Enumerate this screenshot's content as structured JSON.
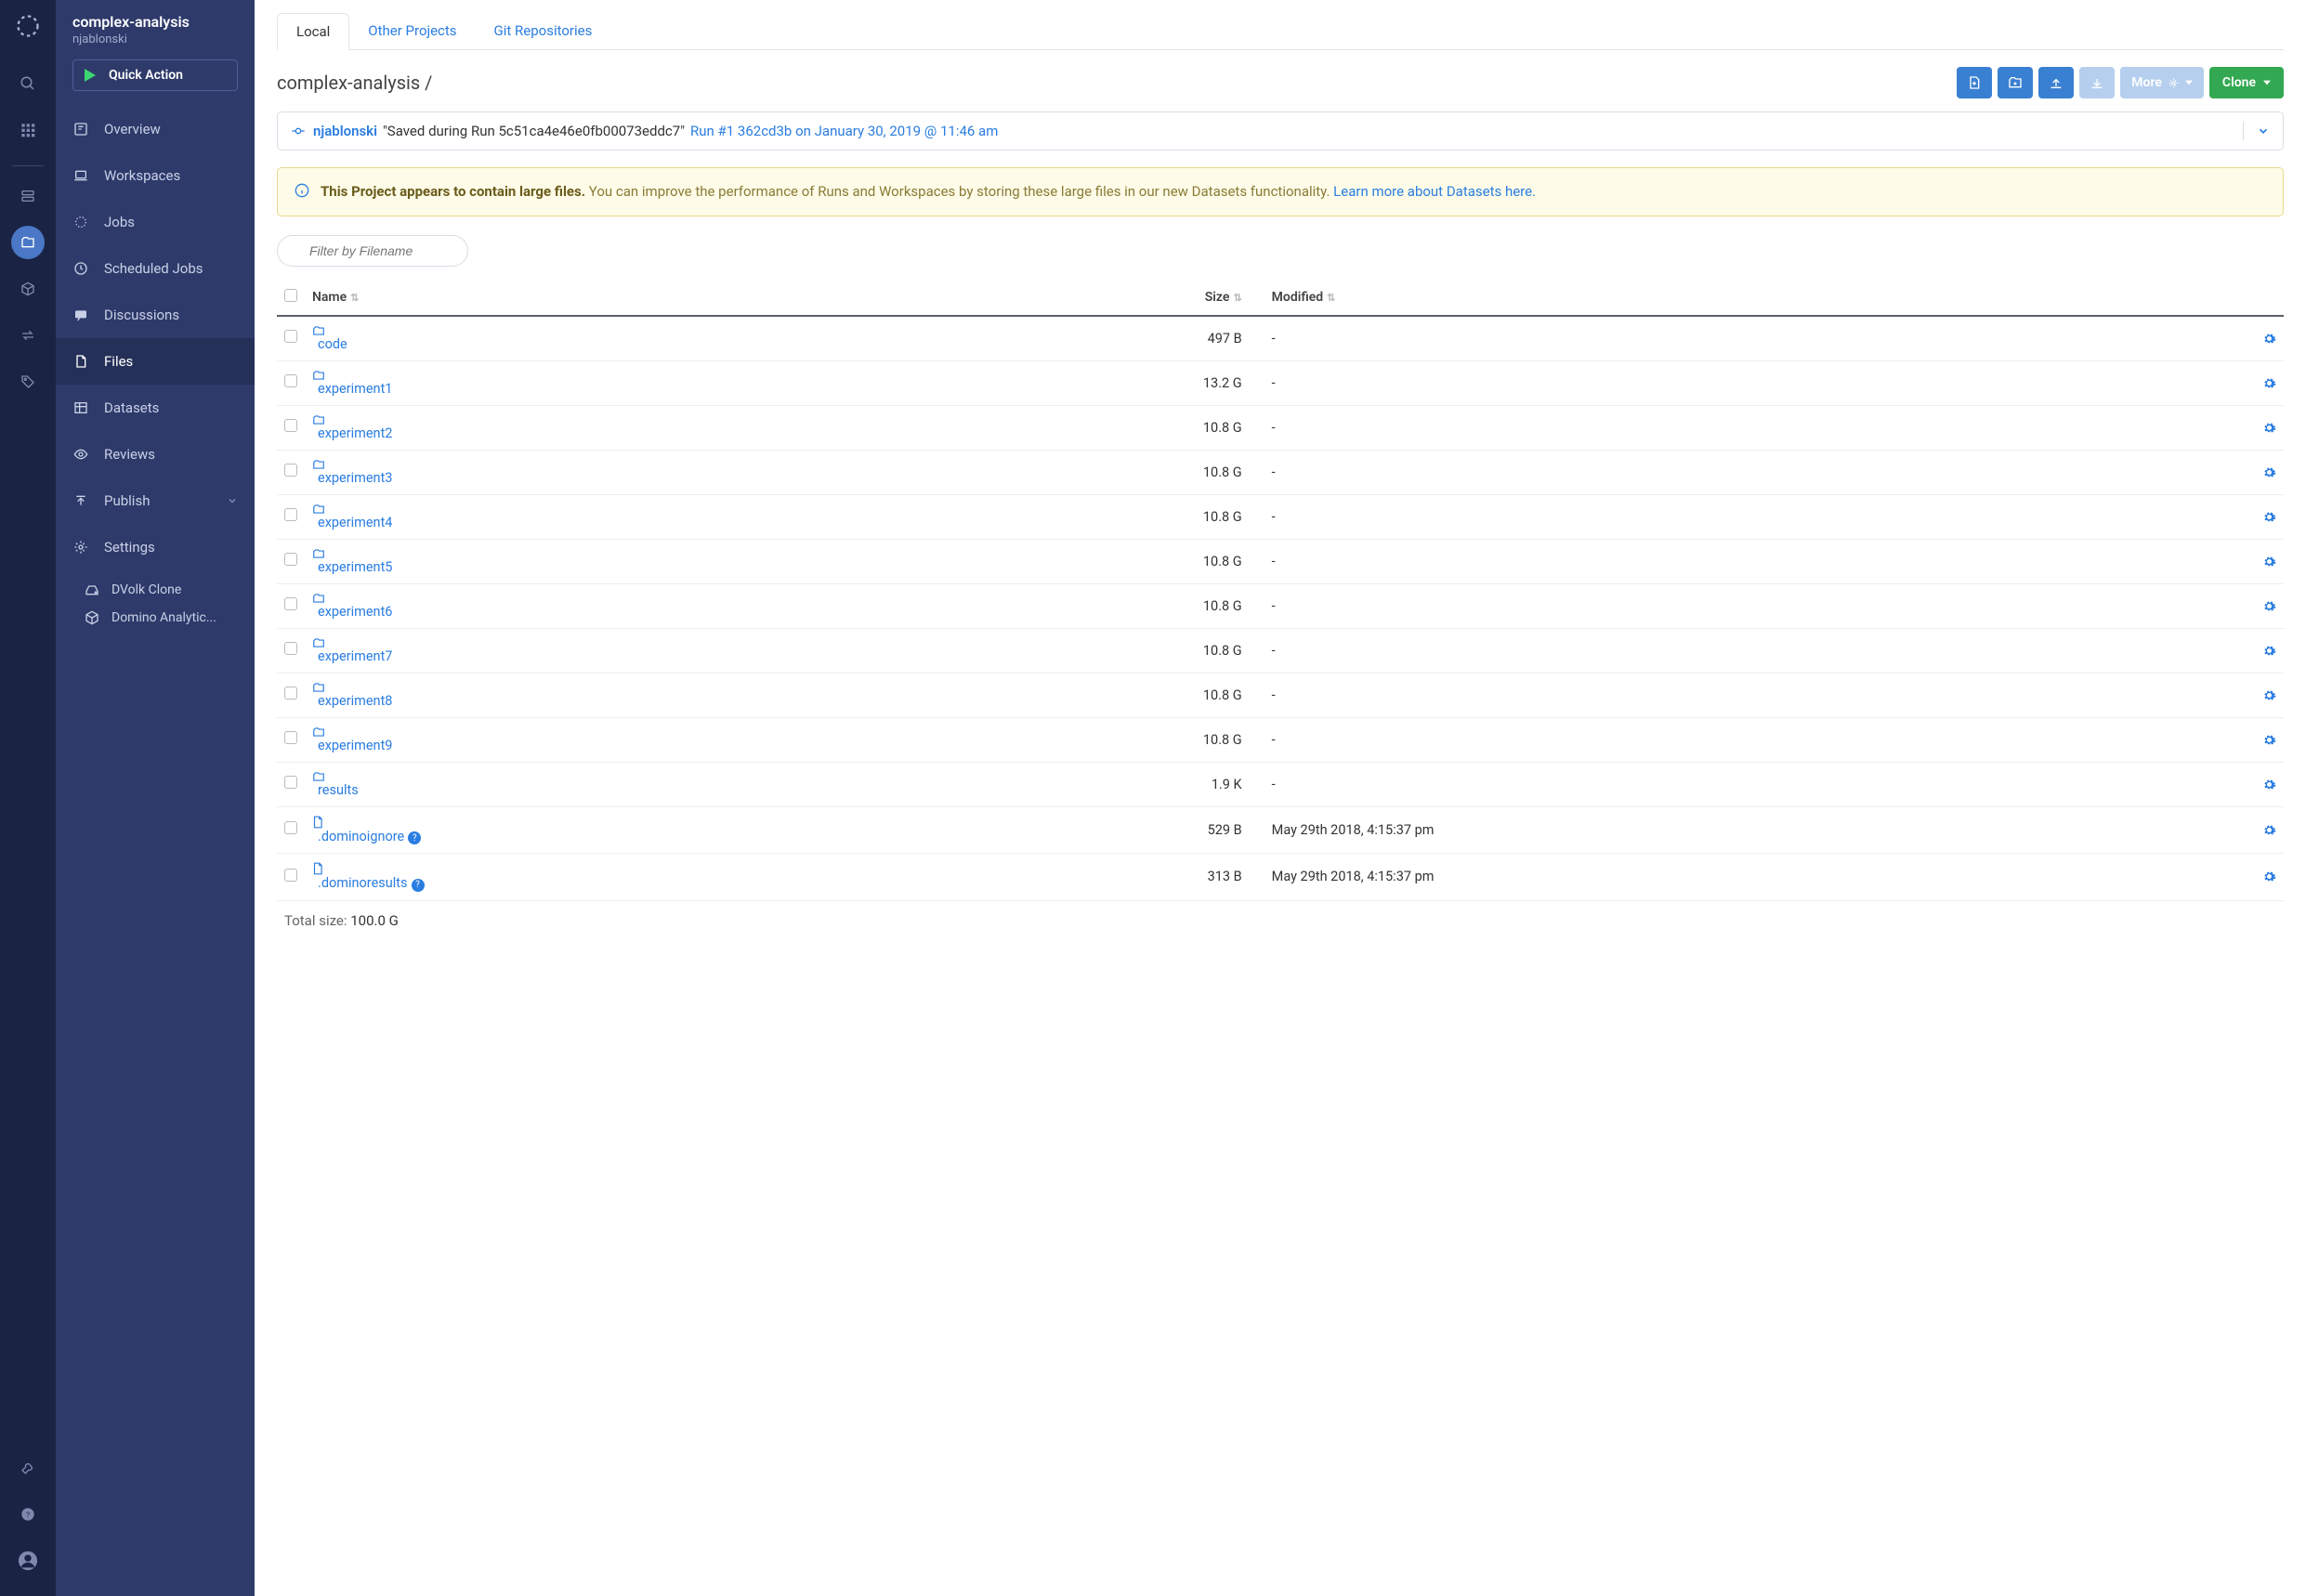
{
  "project": {
    "title": "complex-analysis",
    "owner": "njablonski"
  },
  "quick_action": "Quick Action",
  "nav": {
    "overview": "Overview",
    "workspaces": "Workspaces",
    "jobs": "Jobs",
    "scheduled": "Scheduled Jobs",
    "discussions": "Discussions",
    "files": "Files",
    "datasets": "Datasets",
    "reviews": "Reviews",
    "publish": "Publish",
    "settings": "Settings"
  },
  "drives": {
    "d1": "DVolk Clone",
    "d2": "Domino Analytic..."
  },
  "tabs": {
    "local": "Local",
    "other": "Other Projects",
    "git": "Git Repositories"
  },
  "breadcrumb": {
    "project": "complex-analysis",
    "sep": "  /"
  },
  "toolbar": {
    "more": "More",
    "clone": "Clone"
  },
  "commit": {
    "user": "njablonski",
    "msg": "\"Saved during Run 5c51ca4e46e0fb00073eddc7\"",
    "run": "Run #1 362cd3b on January 30, 2019 @ 11:46 am"
  },
  "alert": {
    "strong": "This Project appears to contain large files.",
    "text": " You can improve the performance of Runs and Workspaces by storing these large files in our new Datasets functionality. ",
    "link": "Learn more about Datasets here."
  },
  "filter": {
    "placeholder": "Filter by Filename"
  },
  "columns": {
    "name": "Name",
    "size": "Size",
    "modified": "Modified"
  },
  "files": [
    {
      "name": "code",
      "type": "folder",
      "size": "497 B",
      "modified": "-"
    },
    {
      "name": "experiment1",
      "type": "folder",
      "size": "13.2 G",
      "modified": "-"
    },
    {
      "name": "experiment2",
      "type": "folder",
      "size": "10.8 G",
      "modified": "-"
    },
    {
      "name": "experiment3",
      "type": "folder",
      "size": "10.8 G",
      "modified": "-"
    },
    {
      "name": "experiment4",
      "type": "folder",
      "size": "10.8 G",
      "modified": "-"
    },
    {
      "name": "experiment5",
      "type": "folder",
      "size": "10.8 G",
      "modified": "-"
    },
    {
      "name": "experiment6",
      "type": "folder",
      "size": "10.8 G",
      "modified": "-"
    },
    {
      "name": "experiment7",
      "type": "folder",
      "size": "10.8 G",
      "modified": "-"
    },
    {
      "name": "experiment8",
      "type": "folder",
      "size": "10.8 G",
      "modified": "-"
    },
    {
      "name": "experiment9",
      "type": "folder",
      "size": "10.8 G",
      "modified": "-"
    },
    {
      "name": "results",
      "type": "folder",
      "size": "1.9 K",
      "modified": "-"
    },
    {
      "name": ".dominoignore",
      "type": "file",
      "help": true,
      "size": "529 B",
      "modified": "May 29th 2018, 4:15:37 pm"
    },
    {
      "name": ".dominoresults",
      "type": "file",
      "help": true,
      "size": "313 B",
      "modified": "May 29th 2018, 4:15:37 pm"
    }
  ],
  "total": {
    "label": "Total size: ",
    "value": "100.0 G"
  }
}
